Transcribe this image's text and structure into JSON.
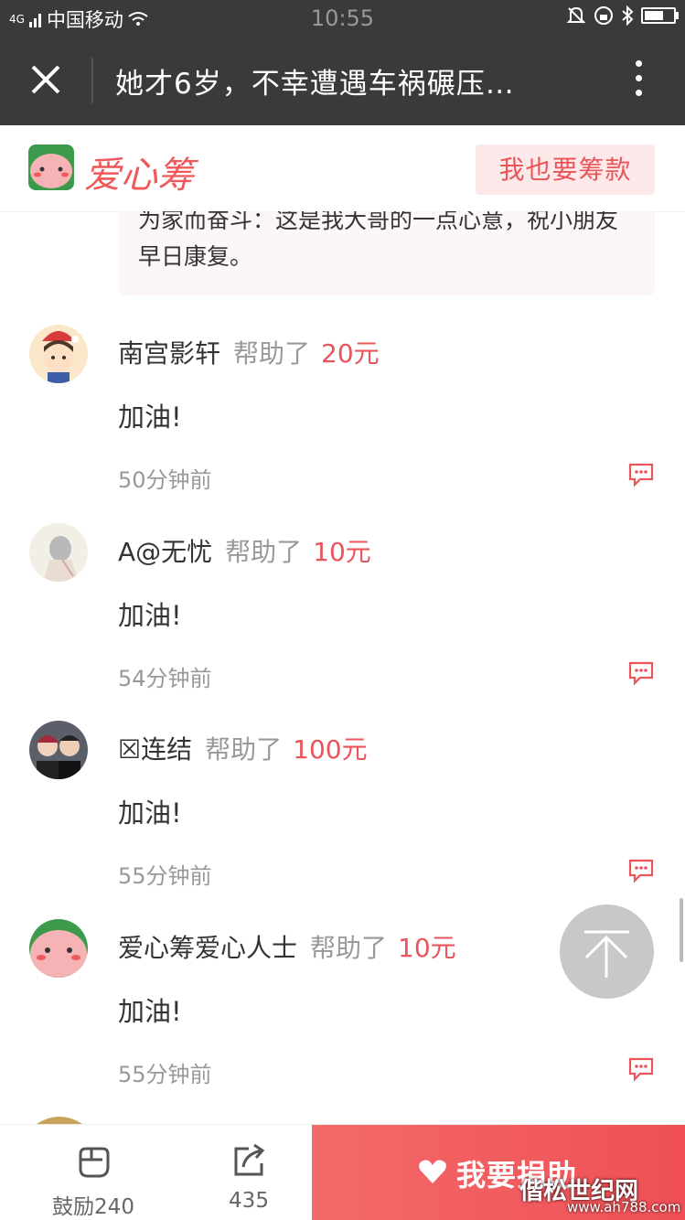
{
  "status_bar": {
    "carrier": "中国移动",
    "signal_label": "4G",
    "time": "10:55"
  },
  "nav": {
    "title": "她才6岁，不幸遭遇车祸碾压…"
  },
  "brand": {
    "name": "爱心筹",
    "raise_button": "我也要筹款"
  },
  "previous_message": {
    "text": "为家而奋斗：这是我大哥的一点心意，祝小朋友早日康复。"
  },
  "donations": [
    {
      "name": "南宫影轩",
      "helped": "帮助了",
      "amount": "20元",
      "comment": "加油!",
      "time": "50分钟前"
    },
    {
      "name": "A@无忧",
      "helped": "帮助了",
      "amount": "10元",
      "comment": "加油!",
      "time": "54分钟前"
    },
    {
      "name": "☒连结",
      "helped": "帮助了",
      "amount": "100元",
      "comment": "加油!",
      "time": "55分钟前"
    },
    {
      "name": "爱心筹爱心人士",
      "helped": "帮助了",
      "amount": "10元",
      "comment": "加油!",
      "time": "55分钟前"
    }
  ],
  "bottom_bar": {
    "encourage_label": "鼓励240",
    "share_label": "435",
    "donate_label": "我要捐助"
  },
  "watermark": {
    "text": "偕松世纪网",
    "url": "www.ah788.com"
  },
  "colors": {
    "accent": "#e9555b",
    "dark_bar": "#3a3a3a"
  }
}
